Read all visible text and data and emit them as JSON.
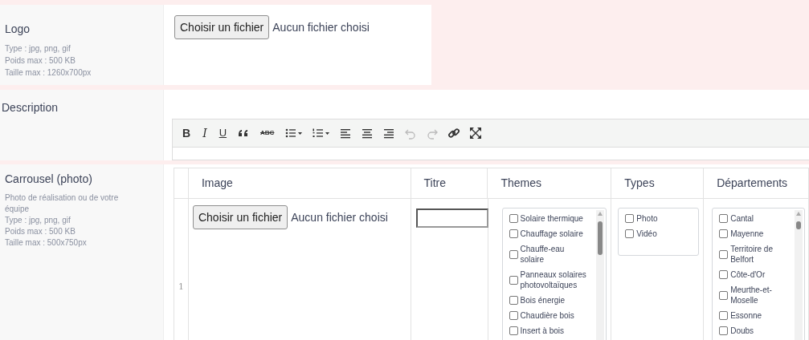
{
  "logo": {
    "label": "Logo",
    "hints": [
      "Type : jpg, png, gif",
      "Poids max : 500 KB",
      "Taille max : 1260x700px"
    ],
    "file_button": "Choisir un fichier",
    "file_status": "Aucun fichier choisi"
  },
  "description": {
    "label": "Description",
    "toolbar": [
      {
        "kind": "glyph",
        "text": "B",
        "disabled": false
      },
      {
        "kind": "glyph",
        "text": "I",
        "disabled": false
      },
      {
        "kind": "glyph",
        "text": "U",
        "disabled": false
      },
      {
        "kind": "icon",
        "disabled": false
      },
      {
        "kind": "glyph",
        "text": "ABC",
        "disabled": false
      },
      {
        "kind": "icon",
        "disabled": false
      },
      {
        "kind": "icon",
        "disabled": false
      },
      {
        "kind": "icon",
        "disabled": false
      },
      {
        "kind": "icon",
        "disabled": false
      },
      {
        "kind": "icon",
        "disabled": false
      },
      {
        "kind": "icon",
        "disabled": true
      },
      {
        "kind": "icon",
        "disabled": true
      },
      {
        "kind": "icon",
        "disabled": false
      },
      {
        "kind": "icon",
        "disabled": false
      }
    ]
  },
  "carousel": {
    "label": "Carrousel (photo)",
    "hints": [
      "Photo de réalisation ou de votre équipe",
      "Type : jpg, png, gif",
      "Poids max : 500 KB",
      "Taille max : 500x750px"
    ],
    "columns": [
      "Image",
      "Titre",
      "Themes",
      "Types",
      "Départements"
    ],
    "rows": [
      {
        "index": "1",
        "file_button": "Choisir un fichier",
        "file_status": "Aucun fichier choisi",
        "themes": [
          {
            "label": "Solaire thermique",
            "checked": false
          },
          {
            "label": "Chauffage solaire",
            "checked": false
          },
          {
            "label": "Chauffe-eau solaire",
            "checked": false
          },
          {
            "label": "Panneaux solaires photovoltaïques",
            "checked": false
          },
          {
            "label": "Bois énergie",
            "checked": false
          },
          {
            "label": "Chaudière bois",
            "checked": false
          },
          {
            "label": "Insert à bois",
            "checked": false
          }
        ],
        "types": [
          {
            "label": "Photo",
            "checked": false
          },
          {
            "label": "Vidéo",
            "checked": false
          }
        ],
        "departements": [
          {
            "label": "Cantal",
            "checked": false
          },
          {
            "label": "Mayenne",
            "checked": false
          },
          {
            "label": "Territoire de Belfort",
            "checked": false
          },
          {
            "label": "Côte-d'Or",
            "checked": false
          },
          {
            "label": "Meurthe-et-Moselle",
            "checked": false
          },
          {
            "label": "Essonne",
            "checked": false
          },
          {
            "label": "Doubs",
            "checked": false
          }
        ]
      }
    ]
  }
}
